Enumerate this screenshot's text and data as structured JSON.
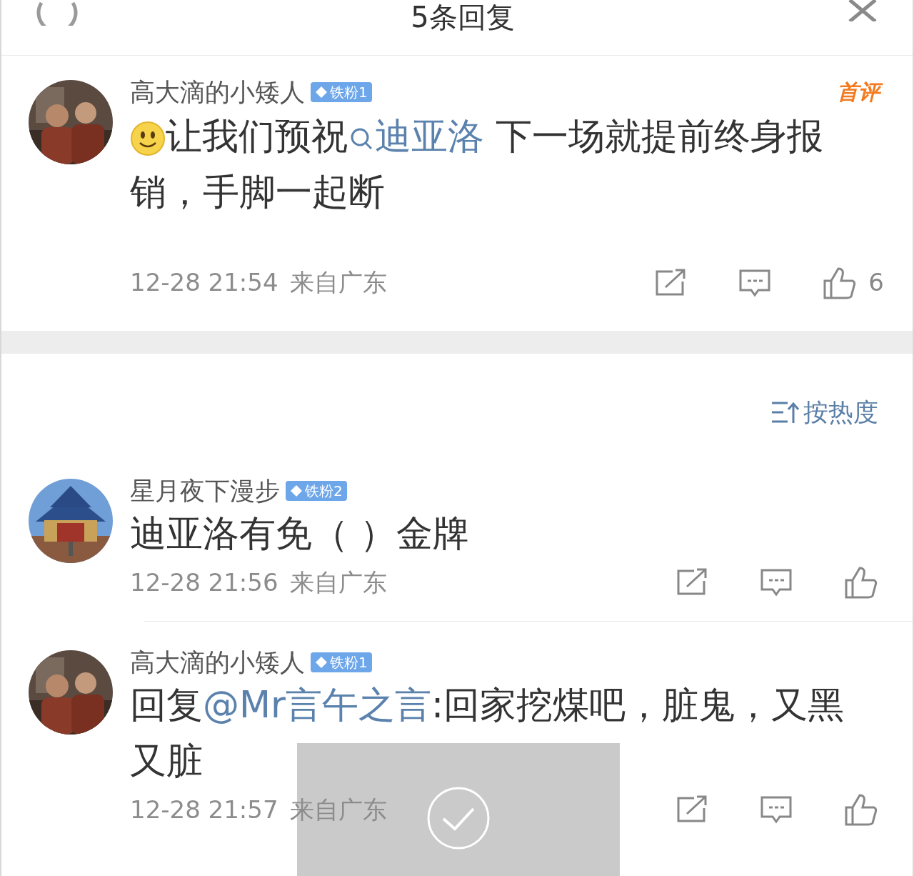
{
  "header": {
    "title": "5条回复"
  },
  "main_comment": {
    "avatar": {
      "kind": "picture"
    },
    "author": "高大滴的小矮人",
    "badge": "铁粉1",
    "tag": "首评",
    "segments": [
      {
        "kind": "emoji"
      },
      {
        "kind": "text",
        "text": "让我们预祝"
      },
      {
        "kind": "topic",
        "text": "迪亚洛"
      },
      {
        "kind": "text",
        "text": " 下一场就提前终身报销，手脚一起断"
      }
    ],
    "time": "12-28 21:54",
    "location": "来自广东",
    "like_count": "6"
  },
  "sort": {
    "label": "按热度"
  },
  "replies": [
    {
      "avatar": {
        "kind": "picture"
      },
      "author": "星月夜下漫步",
      "badge": "铁粉2",
      "segments": [
        {
          "kind": "text",
          "text": "迪亚洛有免（ ）金牌"
        }
      ],
      "time": "12-28 21:56",
      "location": "来自广东"
    },
    {
      "avatar": {
        "kind": "picture"
      },
      "author": "高大滴的小矮人",
      "badge": "铁粉1",
      "segments": [
        {
          "kind": "text",
          "text": "回复"
        },
        {
          "kind": "mention",
          "text": "@Mr言午之言"
        },
        {
          "kind": "text",
          "text": ":回家挖煤吧，脏鬼，又黑又脏"
        }
      ],
      "time": "12-28 21:57",
      "location": "来自广东"
    }
  ],
  "toast": {
    "kind": "success"
  }
}
